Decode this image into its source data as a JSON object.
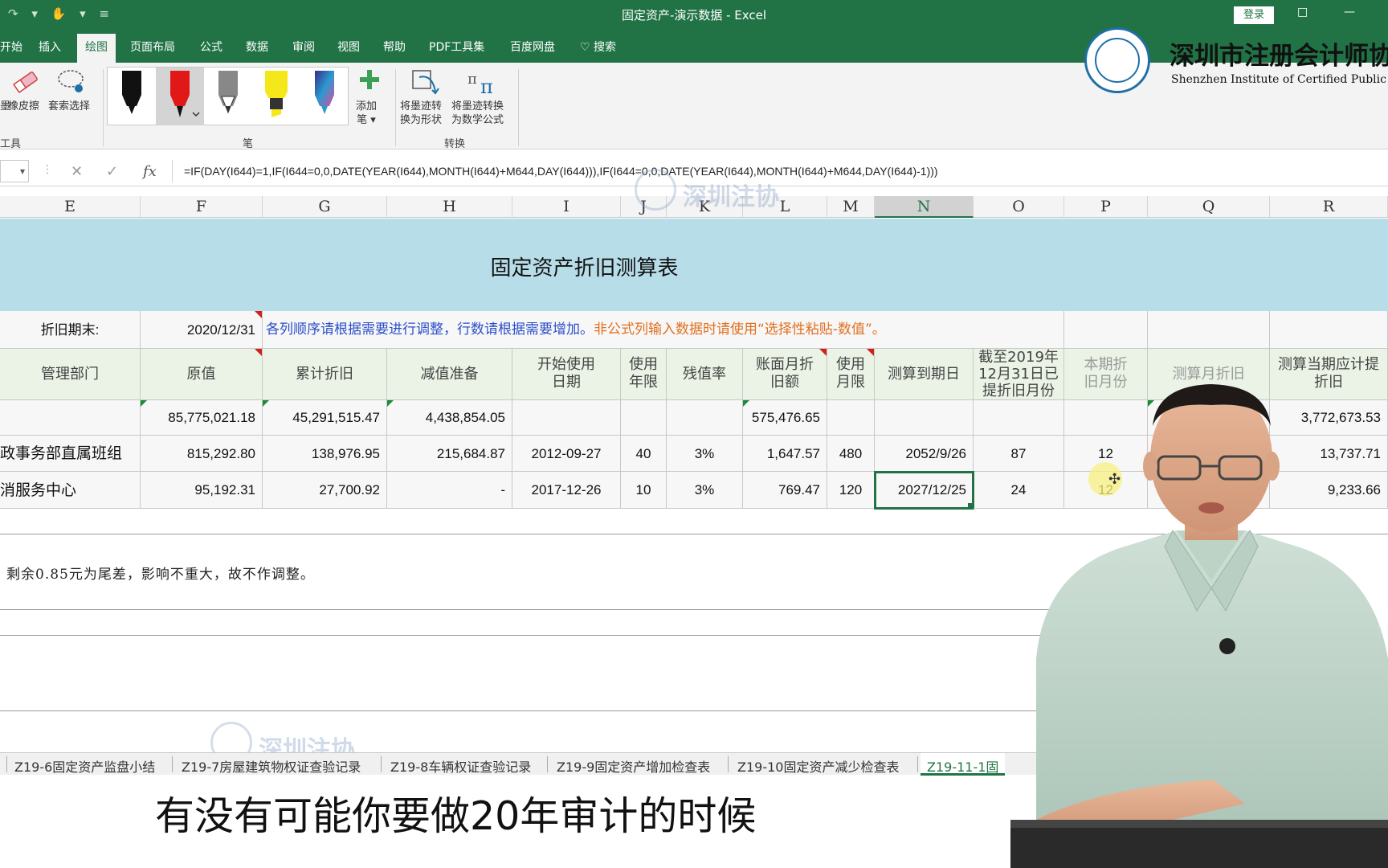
{
  "window": {
    "title": "固定资产-演示数据  -  Excel",
    "login_label": "登录",
    "restore_icon": "□",
    "minimize_icon": "—"
  },
  "ribbon_tabs": [
    "开始",
    "插入",
    "绘图",
    "页面布局",
    "公式",
    "数据",
    "审阅",
    "视图",
    "帮助",
    "PDF工具集",
    "百度网盘",
    "搜索"
  ],
  "active_tab": "绘图",
  "ribbon": {
    "tools_group": {
      "eraser": "橡皮擦",
      "lasso": "套索选择",
      "label": "工具",
      "left_cut_1": "墨",
      "left_cut_2": "ョ"
    },
    "pens_group": {
      "add_pen": "添加\n笔 ▾",
      "label": "笔"
    },
    "convert_group": {
      "ink_to_shape": "将墨迹转\n换为形状",
      "ink_to_math": "将墨迹转换\n为数学公式",
      "label": "转换"
    }
  },
  "logo": {
    "name_cn": "深圳市注册会计师协",
    "name_en": "Shenzhen Institute of Certified Public Acco"
  },
  "formula_bar": {
    "cancel_icon": "✕",
    "confirm_icon": "✓",
    "fx_label": "fx",
    "formula": "=IF(DAY(I644)=1,IF(I644=0,0,DATE(YEAR(I644),MONTH(I644)+M644,DAY(I644))),IF(I644=0,0,DATE(YEAR(I644),MONTH(I644)+M644,DAY(I644)-1)))"
  },
  "columns": [
    "E",
    "F",
    "G",
    "H",
    "I",
    "J",
    "K",
    "L",
    "M",
    "N",
    "O",
    "P",
    "Q",
    "R"
  ],
  "selected_column": "N",
  "sheet": {
    "title": "固定资产折旧测算表",
    "period_label": "折旧期末:",
    "period_value": "2020/12/31",
    "instruction_blue": "各列顺序请根据需要进行调整，行数请根据需要增加。",
    "instruction_orange": "非公式列输入数据时请使用“选择性粘贴-数值”。",
    "headers": [
      "管理部门",
      "原值",
      "累计折旧",
      "减值准备",
      "开始使用\n日期",
      "使用\n年限",
      "残值率",
      "账面月折\n旧额",
      "使用\n月限",
      "测算到期日",
      "截至2019年\n12月31日已\n提折旧月份",
      "本期折\n旧月份",
      "测算月折旧",
      "测算当期应计提\n折旧"
    ],
    "totals": [
      "",
      "85,775,021.18",
      "45,291,515.47",
      "4,438,854.05",
      "",
      "",
      "",
      "575,476.65",
      "",
      "",
      "",
      "",
      "",
      "3,772,673.53"
    ],
    "rows": [
      [
        "政事务部直属班组",
        "815,292.80",
        "138,976.95",
        "215,684.87",
        "2012-09-27",
        "40",
        "3%",
        "1,647.57",
        "480",
        "2052/9/26",
        "87",
        "12",
        "",
        "13,737.71"
      ],
      [
        "消服务中心",
        "95,192.31",
        "27,700.92",
        "-",
        "2017-12-26",
        "10",
        "3%",
        "769.47",
        "120",
        "2027/12/25",
        "24",
        "12",
        "",
        "9,233.66"
      ]
    ],
    "note": "剩余0.85元为尾差，影响不重大，故不作调整。"
  },
  "sheet_tabs": [
    "Z19-6固定资产监盘小结",
    "Z19-7房屋建筑物权证查验记录",
    "Z19-8车辆权证查验记录",
    "Z19-9固定资产增加检查表",
    "Z19-10固定资产减少检查表",
    "Z19-11-1固"
  ],
  "active_sheet_tab": "Z19-11-1固",
  "watermark": "深圳注协",
  "subtitle": "有没有可能你要做20年审计的时候",
  "colors": {
    "excel_green": "#217346",
    "header_band": "#b7dde8",
    "instruction_blue": "#2b4fc9",
    "instruction_orange": "#e07020"
  }
}
